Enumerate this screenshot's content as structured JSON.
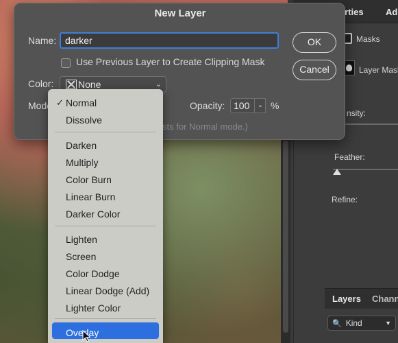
{
  "dialog": {
    "title": "New Layer",
    "name_label": "Name:",
    "name_value": "darker",
    "clipping_label": "Use Previous Layer to Create Clipping Mask",
    "color_label": "Color:",
    "color_value": "None",
    "mode_label": "Mode",
    "opacity_label": "Opacity:",
    "opacity_value": "100",
    "opacity_unit": "%",
    "ok_label": "OK",
    "cancel_label": "Cancel",
    "neutral_hint": "sts for Normal mode.)"
  },
  "mode_menu": {
    "groups": [
      [
        "Normal",
        "Dissolve"
      ],
      [
        "Darken",
        "Multiply",
        "Color Burn",
        "Linear Burn",
        "Darker Color"
      ],
      [
        "Lighten",
        "Screen",
        "Color Dodge",
        "Linear Dodge (Add)",
        "Lighter Color"
      ],
      [
        "Overlay"
      ]
    ],
    "checked": "Normal",
    "highlighted": "Overlay"
  },
  "right_panel": {
    "tab_properties": "operties",
    "tab_adjust": "Ad",
    "masks_label": "Masks",
    "layer_mask_label": "Layer Mask",
    "density_label": "nsity:",
    "feather_label": "Feather:",
    "refine_label": "Refine:",
    "layers_tab": "Layers",
    "channels_tab": "Chann",
    "kind_label": "Kind"
  },
  "colors": {
    "dialog_bg": "#535353",
    "menu_bg": "#ccccc7",
    "highlight": "#2d6fde",
    "input_focus": "#3f7fd6"
  }
}
